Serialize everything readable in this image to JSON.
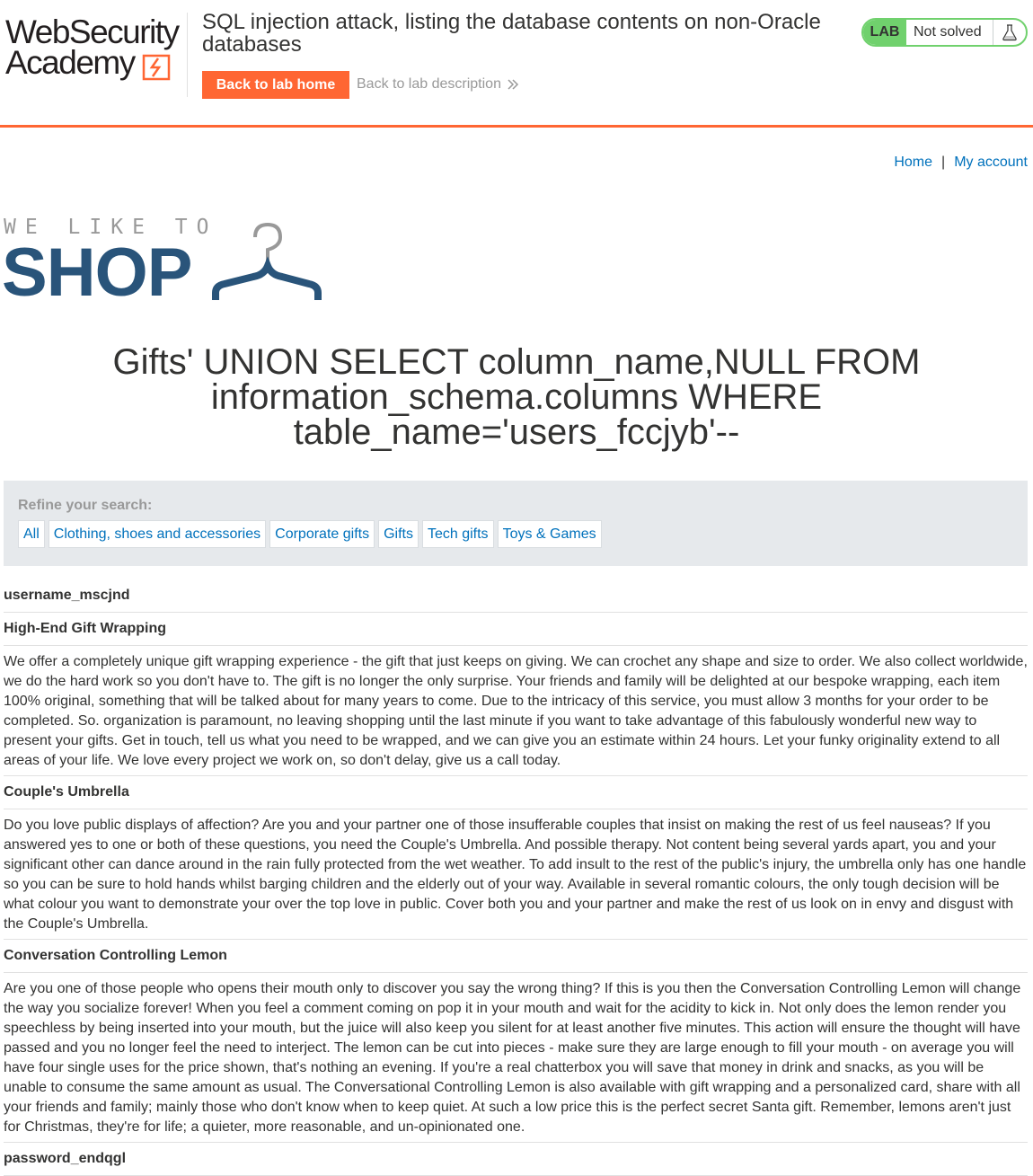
{
  "academy": {
    "logo_line1": "WebSecurity",
    "logo_line2": "Academy",
    "lab_title": "SQL injection attack, listing the database contents on non-Oracle databases",
    "back_home_label": "Back to lab home",
    "back_description_label": "Back to lab description",
    "lab_badge": "LAB",
    "lab_status": "Not solved",
    "accent_color": "#ff6633",
    "status_color": "#70d16d"
  },
  "nav": {
    "home_label": "Home",
    "separator": "|",
    "account_label": "My account"
  },
  "shop_logo": {
    "tagline": "WE LIKE TO",
    "word": "SHOP",
    "brand_color": "#29547a"
  },
  "heading": "Gifts' UNION SELECT column_name,NULL FROM information_schema.columns WHERE table_name='users_fccjyb'--",
  "filters": {
    "refine_label": "Refine your search:",
    "categories": [
      "All",
      "Clothing, shoes and accessories",
      "Corporate gifts",
      "Gifts",
      "Tech gifts",
      "Toys & Games"
    ]
  },
  "results": {
    "row0": "username_mscjnd",
    "row1_name": "High-End Gift Wrapping",
    "row1_desc": "We offer a completely unique gift wrapping experience - the gift that just keeps on giving. We can crochet any shape and size to order. We also collect worldwide, we do the hard work so you don't have to. The gift is no longer the only surprise. Your friends and family will be delighted at our bespoke wrapping, each item 100% original, something that will be talked about for many years to come. Due to the intricacy of this service, you must allow 3 months for your order to be completed. So. organization is paramount, no leaving shopping until the last minute if you want to take advantage of this fabulously wonderful new way to present your gifts. Get in touch, tell us what you need to be wrapped, and we can give you an estimate within 24 hours. Let your funky originality extend to all areas of your life. We love every project we work on, so don't delay, give us a call today.",
    "row2_name": "Couple's Umbrella",
    "row2_desc": "Do you love public displays of affection? Are you and your partner one of those insufferable couples that insist on making the rest of us feel nauseas? If you answered yes to one or both of these questions, you need the Couple's Umbrella. And possible therapy. Not content being several yards apart, you and your significant other can dance around in the rain fully protected from the wet weather. To add insult to the rest of the public's injury, the umbrella only has one handle so you can be sure to hold hands whilst barging children and the elderly out of your way. Available in several romantic colours, the only tough decision will be what colour you want to demonstrate your over the top love in public. Cover both you and your partner and make the rest of us look on in envy and disgust with the Couple's Umbrella.",
    "row3_name": "Conversation Controlling Lemon",
    "row3_desc": "Are you one of those people who opens their mouth only to discover you say the wrong thing? If this is you then the Conversation Controlling Lemon will change the way you socialize forever! When you feel a comment coming on pop it in your mouth and wait for the acidity to kick in. Not only does the lemon render you speechless by being inserted into your mouth, but the juice will also keep you silent for at least another five minutes. This action will ensure the thought will have passed and you no longer feel the need to interject. The lemon can be cut into pieces - make sure they are large enough to fill your mouth - on average you will have four single uses for the price shown, that's nothing an evening. If you're a real chatterbox you will save that money in drink and snacks, as you will be unable to consume the same amount as usual. The Conversational Controlling Lemon is also available with gift wrapping and a personalized card, share with all your friends and family; mainly those who don't know when to keep quiet. At such a low price this is the perfect secret Santa gift. Remember, lemons aren't just for Christmas, they're for life; a quieter, more reasonable, and un-opinionated one.",
    "row4": "password_endqgl"
  }
}
